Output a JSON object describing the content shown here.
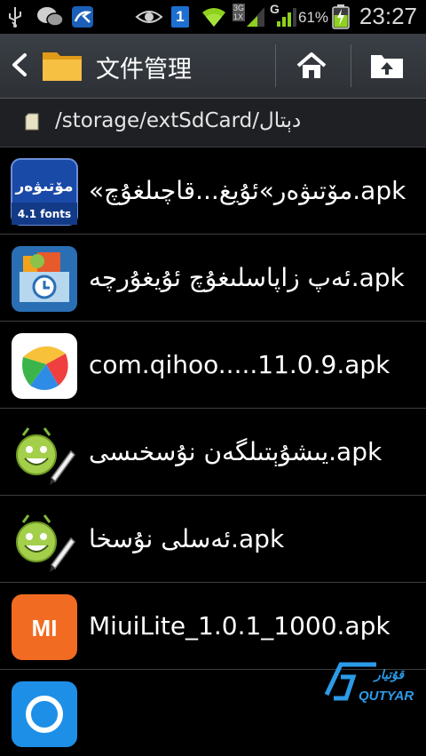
{
  "status_bar": {
    "time": "23:27",
    "battery_percent": "61%",
    "network_type": "G",
    "net_badge": "3G 1X",
    "sim_badge": "1",
    "icons": [
      "usb-icon",
      "wechat-icon",
      "app-notification-icon",
      "eye-icon",
      "sim-icon",
      "wifi-icon",
      "signal-icon",
      "battery-icon"
    ]
  },
  "action_bar": {
    "title": "文件管理",
    "icons": [
      "back-icon",
      "folder-icon",
      "home-icon",
      "up-folder-icon"
    ]
  },
  "path_bar": {
    "path": "/storage/extSdCard/دېتال"
  },
  "files": [
    {
      "name": "«مۆتىۋەر»ئۇيغ...قاچىلغۇچ.apk",
      "icon": "motiwer-fonts-icon",
      "icon_text": "مۆتىۋەر",
      "icon_sub": "4.1 fonts"
    },
    {
      "name": "ئەپ زاپاسلىغۇچ ئۇيغۇرچە.apk",
      "icon": "app-backup-icon"
    },
    {
      "name": "com.qihoo.....11.0.9.apk",
      "icon": "qihoo-store-icon"
    },
    {
      "name": "يىشۇېتىلگەن نۇسخىسى.apk",
      "icon": "android-apk-icon"
    },
    {
      "name": "ئەسلى نۇسخا.apk",
      "icon": "android-apk-icon"
    },
    {
      "name": "MiuiLite_1.0.1_1000.apk",
      "icon": "mi-icon",
      "icon_text": "MI"
    },
    {
      "name": "",
      "icon": "partial-app-icon"
    }
  ],
  "watermark": {
    "text": "QUTYAR"
  }
}
